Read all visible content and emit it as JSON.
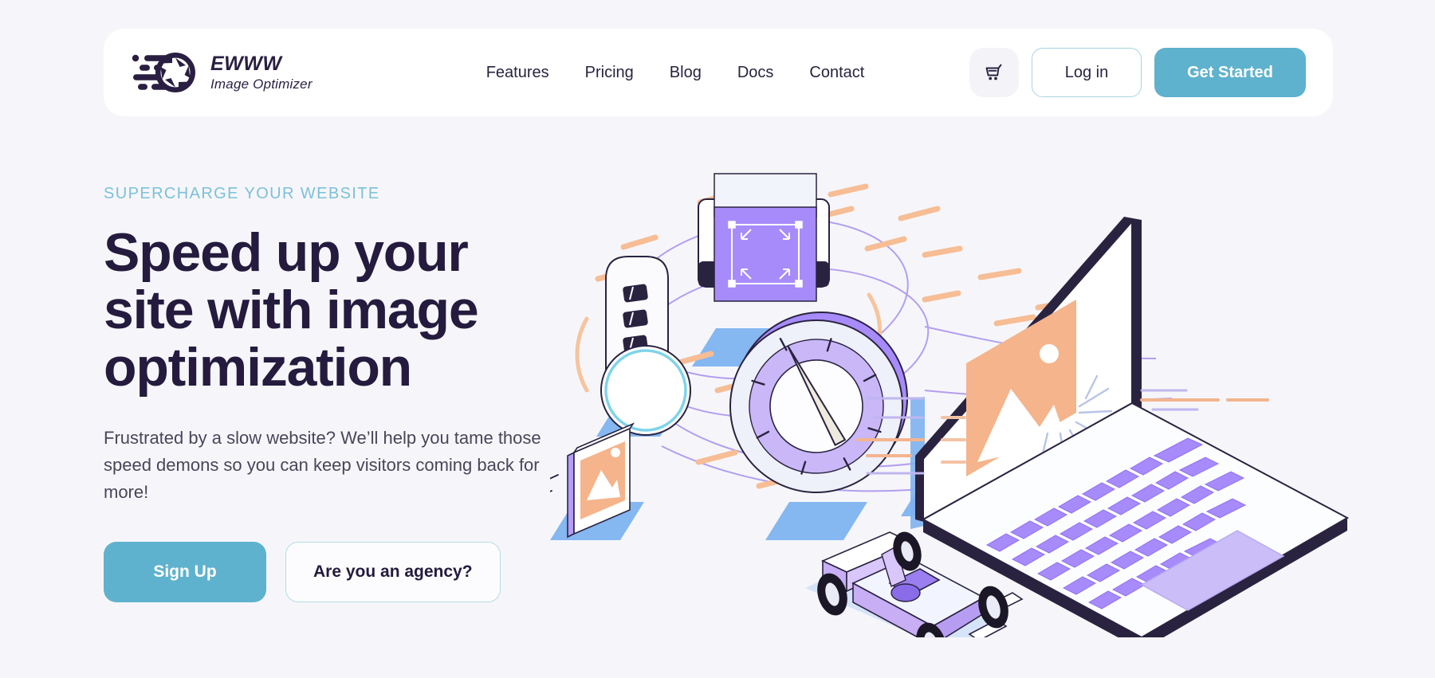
{
  "brand": {
    "name": "EWWW",
    "subtitle": "Image Optimizer",
    "logo_icon": "camera-aperture-speed-icon"
  },
  "nav": {
    "items": [
      {
        "label": "Features"
      },
      {
        "label": "Pricing"
      },
      {
        "label": "Blog"
      },
      {
        "label": "Docs"
      },
      {
        "label": "Contact"
      }
    ]
  },
  "header_actions": {
    "cart_icon": "shopping-cart-icon",
    "login_label": "Log in",
    "get_started_label": "Get Started"
  },
  "hero": {
    "eyebrow": "SUPERCHARGE YOUR WEBSITE",
    "title_line1": "Speed up your",
    "title_line2": "site with image",
    "title_line3": "optimization",
    "subtitle": "Frustrated by a slow website? We’ll help you tame those speed demons so you can keep visitors coming back for more!",
    "primary_cta": "Sign Up",
    "secondary_cta": "Are you an agency?"
  },
  "illustration": {
    "alt": "isometric illustration of a laptop, race car, speedometer gauge and image cards",
    "elements": [
      "laptop-isometric",
      "race-car-isometric",
      "speedometer-gauge",
      "image-card-floating",
      "image-resize-tool",
      "slider-card",
      "speed-dashes",
      "swirl-lines"
    ]
  },
  "colors": {
    "page_background": "#f6f6fa",
    "card_background": "#ffffff",
    "accent_teal": "#5fb2cd",
    "eyebrow_blue": "#7cc0d8",
    "heading_navy": "#241b3e",
    "body_text": "#4a4559",
    "illustration_purple": "#a78bfa",
    "illustration_orange": "#f5b48b",
    "illustration_blue": "#6aa9ee",
    "outline_dark": "#2a2340"
  }
}
